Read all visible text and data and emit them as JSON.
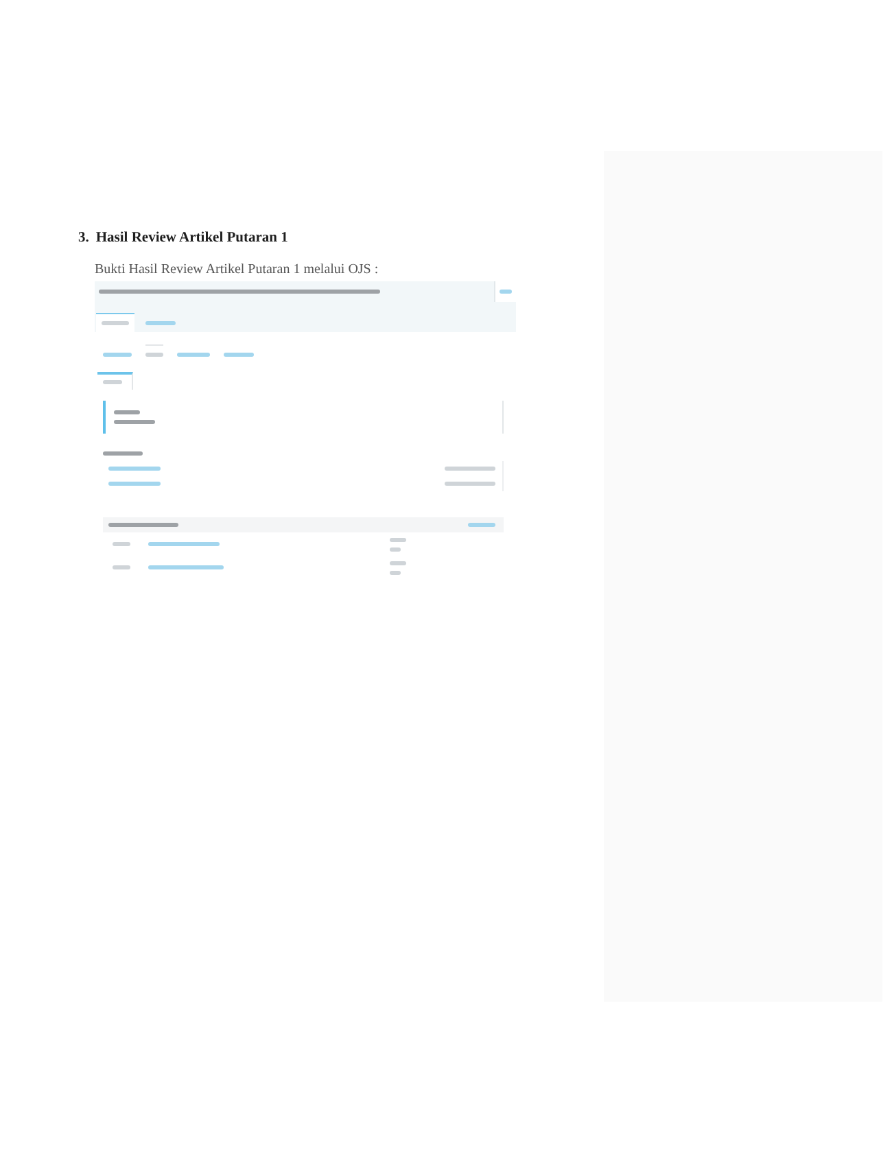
{
  "heading": {
    "number": "3.",
    "title": "Hasil Review Artikel Putaran 1"
  },
  "caption": "Bukti Hasil Review Artikel Putaran 1 melalui OJS :",
  "screenshot": {
    "workflow_tabs": [
      {
        "selected": true
      },
      {
        "selected": false
      }
    ],
    "stage_tabs": [
      {
        "selected": false
      },
      {
        "selected": true
      },
      {
        "selected": false
      },
      {
        "selected": false
      }
    ],
    "round_tabs": [
      {
        "selected": true
      }
    ]
  }
}
